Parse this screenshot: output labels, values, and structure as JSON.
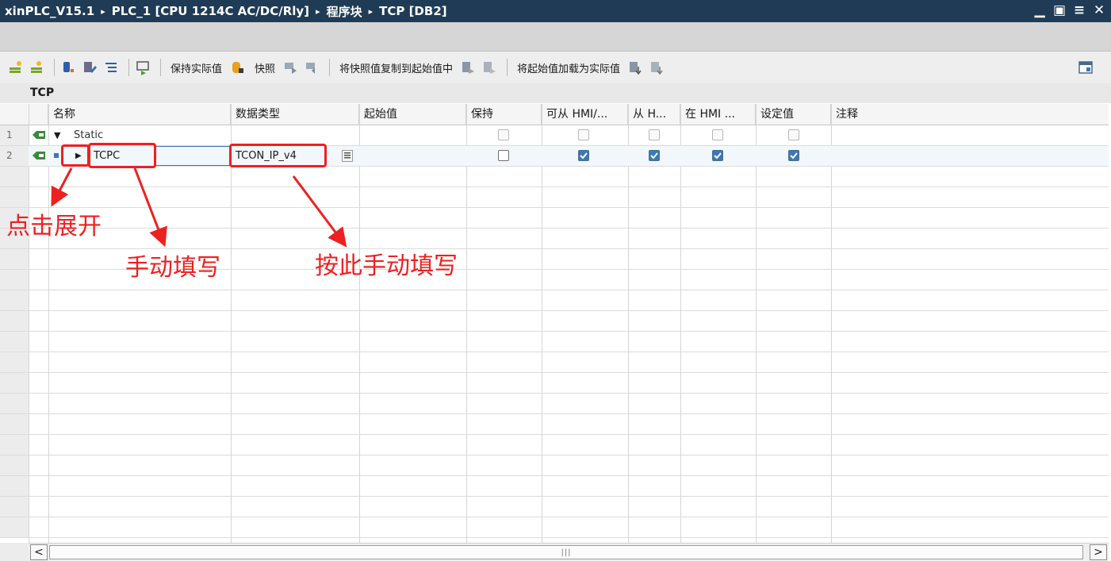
{
  "titlebar": {
    "crumbs": [
      "xinPLC_V15.1",
      "PLC_1 [CPU 1214C AC/DC/Rly]",
      "程序块",
      "TCP [DB2]"
    ],
    "separator": "▸",
    "minimize": "▁",
    "restore": "▣",
    "float": "≡",
    "close": "✕"
  },
  "toolbar": {
    "keep_actual": "保持实际值",
    "snapshot": "快照",
    "copy_snapshot": "将快照值复制到起始值中",
    "load_start": "将起始值加载为实际值"
  },
  "block_name": "TCP",
  "columns": [
    "名称",
    "数据类型",
    "起始值",
    "保持",
    "可从 HMI/...",
    "从 H...",
    "在 HMI ...",
    "设定值",
    "注释"
  ],
  "rows": [
    {
      "num": "1",
      "name": "Static",
      "expander": "▼",
      "type": "",
      "retain": false,
      "hmi_access": false,
      "hmi_write": false,
      "hmi_visible": false,
      "setpoint": false
    },
    {
      "num": "2",
      "name": "TCPC",
      "expander": "▶",
      "type": "TCON_IP_v4",
      "retain": false,
      "hmi_access": true,
      "hmi_write": true,
      "hmi_visible": true,
      "setpoint": true
    }
  ],
  "scrollbar": {
    "left": "<",
    "right": ">",
    "grip": "|||"
  },
  "annotations": {
    "click_expand": "点击展开",
    "manual_fill": "手动填写",
    "manual_fill_type": "按此手动填写"
  },
  "colors": {
    "title_bg": "#1f3b55",
    "annotation": "#ee2020",
    "checkbox": "#3a78b8"
  },
  "icons": [
    "add-row-icon",
    "insert-row-icon",
    "db-icon",
    "edit-icon",
    "list-icon",
    "monitor-icon",
    "db-snapshot-icon",
    "copy-icon",
    "load-icon",
    "split-view-icon"
  ]
}
